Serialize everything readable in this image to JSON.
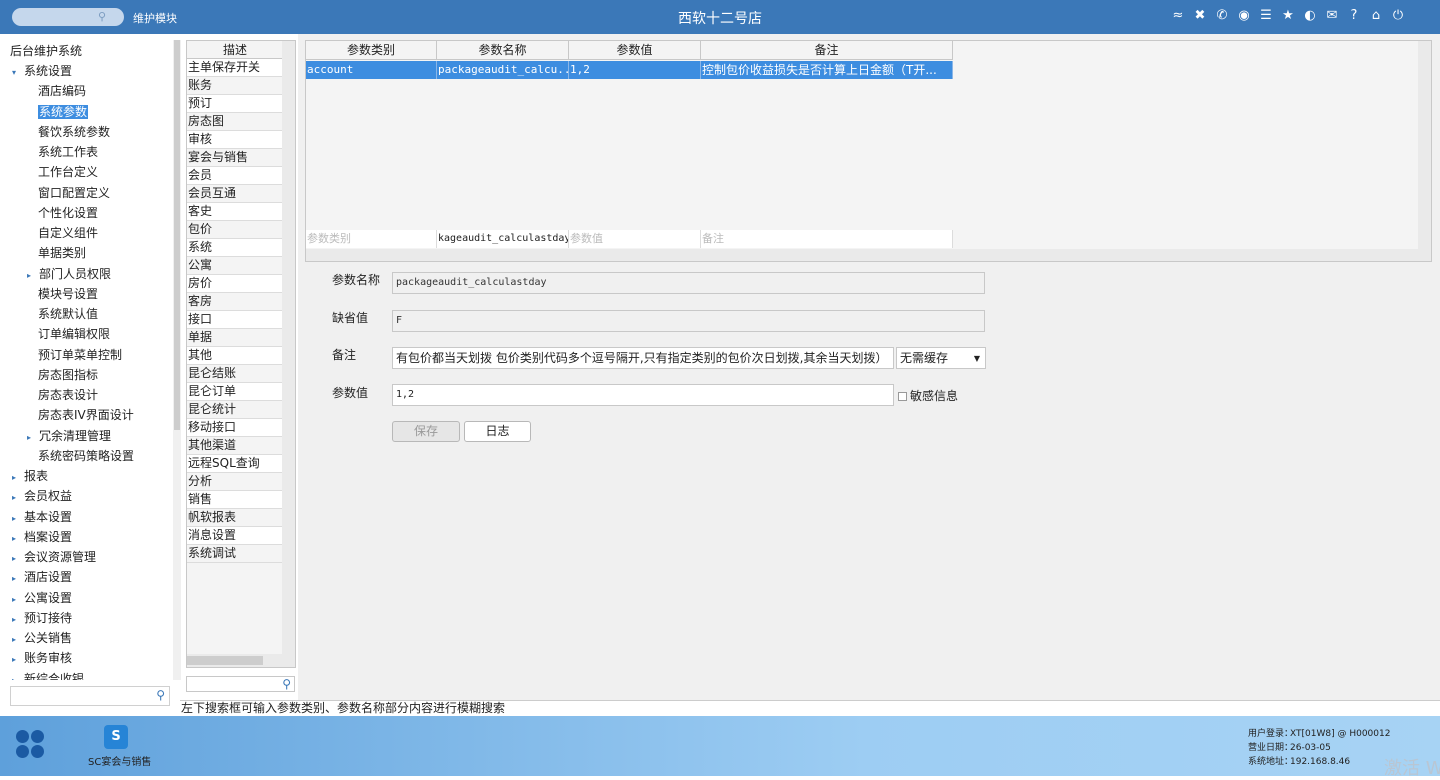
{
  "topbar": {
    "module_label": "维护模块",
    "hotel_title": "西软十二号店",
    "icons": [
      "wifi-icon",
      "tools-icon",
      "phone-icon",
      "palette-icon",
      "menu-icon",
      "star-icon",
      "theme-icon",
      "mail-icon",
      "help-icon",
      "home-icon",
      "power-icon"
    ]
  },
  "nav": {
    "root": "后台维护系统",
    "items": [
      {
        "label": "系统设置",
        "level": 1,
        "arrow": "▾"
      },
      {
        "label": "酒店编码",
        "level": 2
      },
      {
        "label": "系统参数",
        "level": 2,
        "selected": true
      },
      {
        "label": "餐饮系统参数",
        "level": 2
      },
      {
        "label": "系统工作表",
        "level": 2
      },
      {
        "label": "工作台定义",
        "level": 2
      },
      {
        "label": "窗口配置定义",
        "level": 2
      },
      {
        "label": "个性化设置",
        "level": 2
      },
      {
        "label": "自定义组件",
        "level": 2
      },
      {
        "label": "单据类别",
        "level": 2
      },
      {
        "label": "部门人员权限",
        "level": 2,
        "arrow": "▸"
      },
      {
        "label": "模块号设置",
        "level": 2
      },
      {
        "label": "系统默认值",
        "level": 2
      },
      {
        "label": "订单编辑权限",
        "level": 2
      },
      {
        "label": "预订单菜单控制",
        "level": 2
      },
      {
        "label": "房态图指标",
        "level": 2
      },
      {
        "label": "房态表设计",
        "level": 2
      },
      {
        "label": "房态表IV界面设计",
        "level": 2
      },
      {
        "label": "冗余清理管理",
        "level": 2,
        "arrow": "▸"
      },
      {
        "label": "系统密码策略设置",
        "level": 2
      },
      {
        "label": "报表",
        "level": 1,
        "arrow": "▸"
      },
      {
        "label": "会员权益",
        "level": 1,
        "arrow": "▸"
      },
      {
        "label": "基本设置",
        "level": 1,
        "arrow": "▸"
      },
      {
        "label": "档案设置",
        "level": 1,
        "arrow": "▸"
      },
      {
        "label": "会议资源管理",
        "level": 1,
        "arrow": "▸"
      },
      {
        "label": "酒店设置",
        "level": 1,
        "arrow": "▸"
      },
      {
        "label": "公寓设置",
        "level": 1,
        "arrow": "▸"
      },
      {
        "label": "预订接待",
        "level": 1,
        "arrow": "▸"
      },
      {
        "label": "公关销售",
        "level": 1,
        "arrow": "▸"
      },
      {
        "label": "账务审核",
        "level": 1,
        "arrow": "▸"
      },
      {
        "label": "新综合收银",
        "level": 1,
        "arrow": "▸"
      }
    ]
  },
  "desc_list": {
    "header": "描述",
    "items": [
      "主单保存开关",
      "账务",
      "预订",
      "房态图",
      "审核",
      "宴会与销售",
      "会员",
      "会员互通",
      "客史",
      "包价",
      "系统",
      "公寓",
      "房价",
      "客房",
      "接口",
      "单据",
      "其他",
      "昆仑结账",
      "昆仑订单",
      "昆仑统计",
      "移动接口",
      "其他渠道",
      "远程SQL查询",
      "分析",
      "销售",
      "帆软报表",
      "消息设置",
      "系统调试"
    ]
  },
  "grid": {
    "headers": [
      "参数类别",
      "参数名称",
      "参数值",
      "备注"
    ],
    "rows": [
      {
        "category": "account",
        "name": "packageaudit_calcu...",
        "value": "1,2",
        "remark": "控制包价收益损失是否计算上日金额（T开..."
      }
    ],
    "filter": {
      "category_placeholder": "参数类别",
      "name_value": "kageaudit_calculastday",
      "value_placeholder": "参数值",
      "remark_placeholder": "备注"
    }
  },
  "form": {
    "name_label": "参数名称",
    "name_value": "packageaudit_calculastday",
    "default_label": "缺省值",
    "default_value": "F",
    "remark_label": "备注",
    "remark_value": "有包价都当天划拨 包价类别代码多个逗号隔开,只有指定类别的包价次日划拨,其余当天划拨）",
    "cache_option": "无需缓存",
    "value_label": "参数值",
    "param_value": "1,2",
    "sensitive_label": "敏感信息",
    "sensitive_checked": false,
    "save_label": "保存",
    "log_label": "日志"
  },
  "status_text": "左下搜索框可输入参数类别、参数名称部分内容进行模糊搜索",
  "taskbar": {
    "app_icon_letter": "S",
    "app_label": "SC宴会与销售",
    "user_key": "用户登录：",
    "user_val": "XT[01W8] @ H000012",
    "date_key": "营业日期：",
    "date_val": "26-03-05",
    "addr_key": "系统地址：",
    "addr_val": "192.168.8.46"
  },
  "watermark": "激活 W"
}
